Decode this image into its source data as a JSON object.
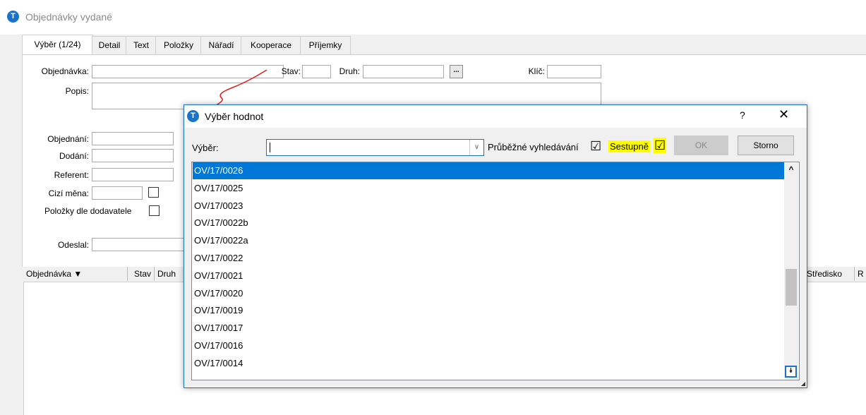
{
  "window": {
    "title": "Objednávky vydané"
  },
  "tabs": [
    {
      "label": "Výběr (1/24)"
    },
    {
      "label": "Detail"
    },
    {
      "label": "Text"
    },
    {
      "label": "Položky"
    },
    {
      "label": "Nářadí"
    },
    {
      "label": "Kooperace"
    },
    {
      "label": "Příjemky"
    }
  ],
  "form": {
    "objednavka_label": "Objednávka:",
    "stav_label": "Stav:",
    "druh_label": "Druh:",
    "dots": "...",
    "klic_label": "Klíč:",
    "popis_label": "Popis:",
    "objednani_label": "Objednání:",
    "dodani_label": "Dodání:",
    "referent_label": "Referent:",
    "cizi_mena_label": "Cizí měna:",
    "polozky_dle_label": "Položky dle dodavatele",
    "odeslal_label": "Odeslal:"
  },
  "grid": {
    "columns_left": [
      "Objednávka ▼",
      "Stav",
      "Druh"
    ],
    "columns_right": [
      "Středisko",
      "R"
    ]
  },
  "dialog": {
    "title": "Výběr hodnot",
    "help": "?",
    "close": "✕",
    "vyber_label": "Výběr:",
    "search_value": "",
    "combo_arrow": "∨",
    "prubezne_label": "Průběžné vyhledávání",
    "prubezne_checked": "☑",
    "sestupne_label": "Sestupně",
    "sestupne_checked": "☑",
    "ok_label": "OK",
    "storno_label": "Storno",
    "scroll_up": "^",
    "scroll_end": "⯯",
    "highlight_color": "#ffff00",
    "selection_color": "#0078d7",
    "items": [
      "OV/17/0026",
      "OV/17/0025",
      "OV/17/0023",
      "OV/17/0022b",
      "OV/17/0022a",
      "OV/17/0022",
      "OV/17/0021",
      "OV/17/0020",
      "OV/17/0019",
      "OV/17/0017",
      "OV/17/0016",
      "OV/17/0014"
    ],
    "selected_index": 0
  },
  "annotation": {
    "color": "#e02020",
    "icon": "red-arrow-annotation"
  }
}
